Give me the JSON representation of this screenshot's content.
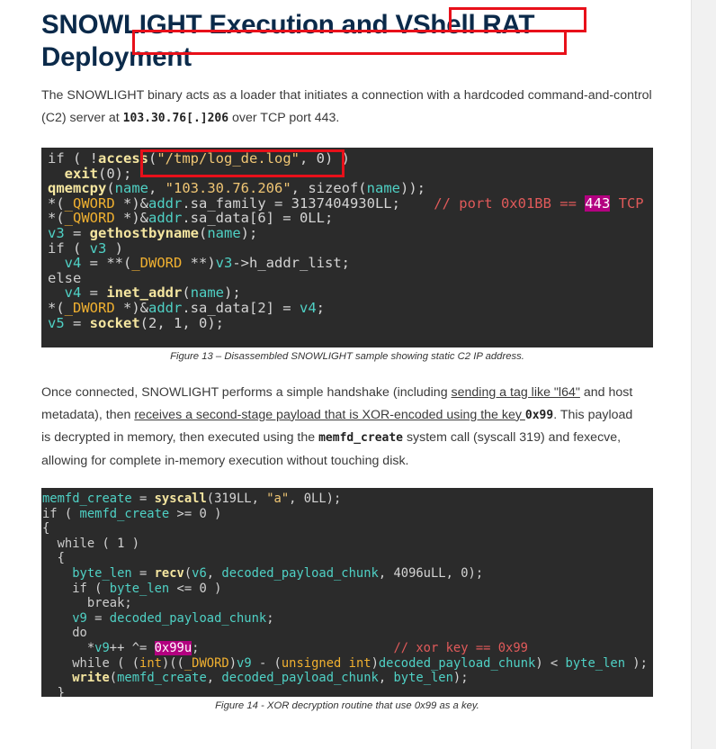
{
  "heading": "SNOWLIGHT Execution and VShell RAT Deployment",
  "intro": {
    "text_before": "The SNOWLIGHT binary acts as a loader that initiates a connection with a hardcoded command-and-control (C2) server at ",
    "ip_code": "103.30.76[.]206",
    "text_after": " over TCP port 443."
  },
  "figure13": {
    "caption": "Figure 13 – Disassembled SNOWLIGHT sample showing static C2 IP address."
  },
  "paragraph2": {
    "line1_a": "Once connected, SNOWLIGHT performs a simple handshake (including ",
    "line1_hl": "sending a tag like \"l64\"",
    "line1_b": " and host",
    "line2_a": "metadata), then ",
    "line2_hl": "receives a second-stage payload that is XOR-encoded using the key ",
    "line2_code": "0x99",
    "line2_b": ". This payload",
    "line3": "is decrypted in memory, then executed using the ",
    "line3_code": "memfd_create",
    "line3_b": " system call (syscall 319) and fexecve,",
    "line4": "allowing for complete in-memory execution without touching disk."
  },
  "figure14": {
    "caption": "Figure 14 - XOR decryption routine that use 0x99 as a key."
  },
  "colors": {
    "heading": "#0b2a4a",
    "code_bg": "#2b2b2b",
    "highlight_box": "#e8101a"
  }
}
